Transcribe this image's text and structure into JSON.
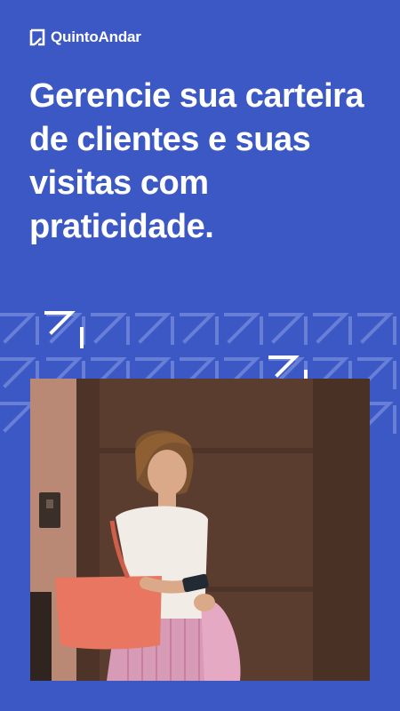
{
  "brand": {
    "name": "QuintoAndar",
    "icon": "quintoandar-logo-icon"
  },
  "headline": "Gerencie sua carteira de clientes e suas visitas com praticidade.",
  "colors": {
    "background": "#3c58c4",
    "text": "#ffffff",
    "pattern": "#6f86da"
  },
  "hero_image": {
    "subject": "woman-smiling-at-phone-icon"
  }
}
